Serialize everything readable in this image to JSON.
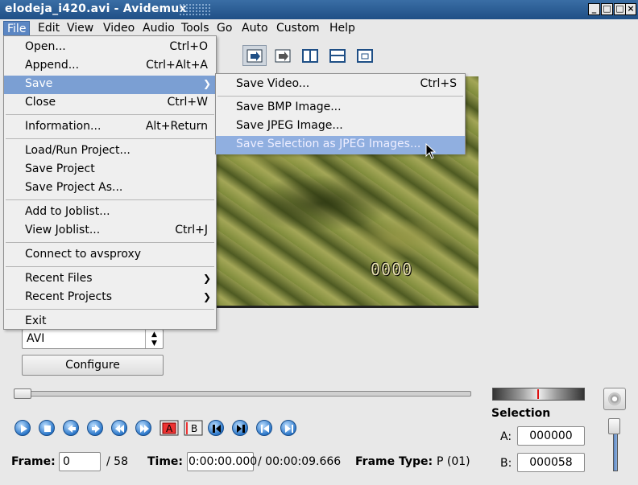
{
  "window": {
    "title": "elodeja_i420.avi - Avidemux"
  },
  "menubar": [
    "File",
    "Edit",
    "View",
    "Video",
    "Audio",
    "Tools",
    "Go",
    "Auto",
    "Custom",
    "Help"
  ],
  "file_menu": [
    {
      "label": "Open...",
      "accel": "Ctrl+O"
    },
    {
      "label": "Append...",
      "accel": "Ctrl+Alt+A"
    },
    {
      "label": "Save",
      "accel": "",
      "submenu": true
    },
    {
      "label": "Close",
      "accel": "Ctrl+W"
    },
    {
      "label": "Information...",
      "accel": "Alt+Return"
    },
    {
      "label": "Load/Run Project...",
      "accel": ""
    },
    {
      "label": "Save Project",
      "accel": ""
    },
    {
      "label": "Save Project As...",
      "accel": ""
    },
    {
      "label": "Add to Joblist...",
      "accel": ""
    },
    {
      "label": "View Joblist...",
      "accel": "Ctrl+J"
    },
    {
      "label": "Connect to avsproxy",
      "accel": ""
    },
    {
      "label": "Recent Files",
      "accel": "",
      "submenu": true
    },
    {
      "label": "Recent Projects",
      "accel": "",
      "submenu": true
    },
    {
      "label": "Exit",
      "accel": ""
    }
  ],
  "save_submenu": [
    {
      "label": "Save Video...",
      "accel": "Ctrl+S"
    },
    {
      "label": "Save BMP Image...",
      "accel": ""
    },
    {
      "label": "Save JPEG Image...",
      "accel": ""
    },
    {
      "label": "Save Selection as JPEG Images...",
      "accel": ""
    }
  ],
  "video": {
    "overlay_text": "0000"
  },
  "left_panel": {
    "format_value": "AVI",
    "configure_label": "Configure"
  },
  "seek": {
    "position": 0.0
  },
  "playback_markers": {
    "a_label": "A",
    "b_label": "B"
  },
  "info": {
    "frame_label": "Frame:",
    "frame_value": "0",
    "frame_total": "/ 58",
    "time_label": "Time:",
    "time_value": "0:00:00.000",
    "time_total": "/ 00:00:09.666",
    "frametype_label": "Frame Type:",
    "frametype_value": "P (01)"
  },
  "selection": {
    "title": "Selection",
    "a_label": "A:",
    "a_value": "000000",
    "b_label": "B:",
    "b_value": "000058"
  },
  "colors": {
    "titlebar": "#2a5d96",
    "menu_highlight": "#7b9fd3",
    "submenu_highlight": "#90afe0"
  }
}
